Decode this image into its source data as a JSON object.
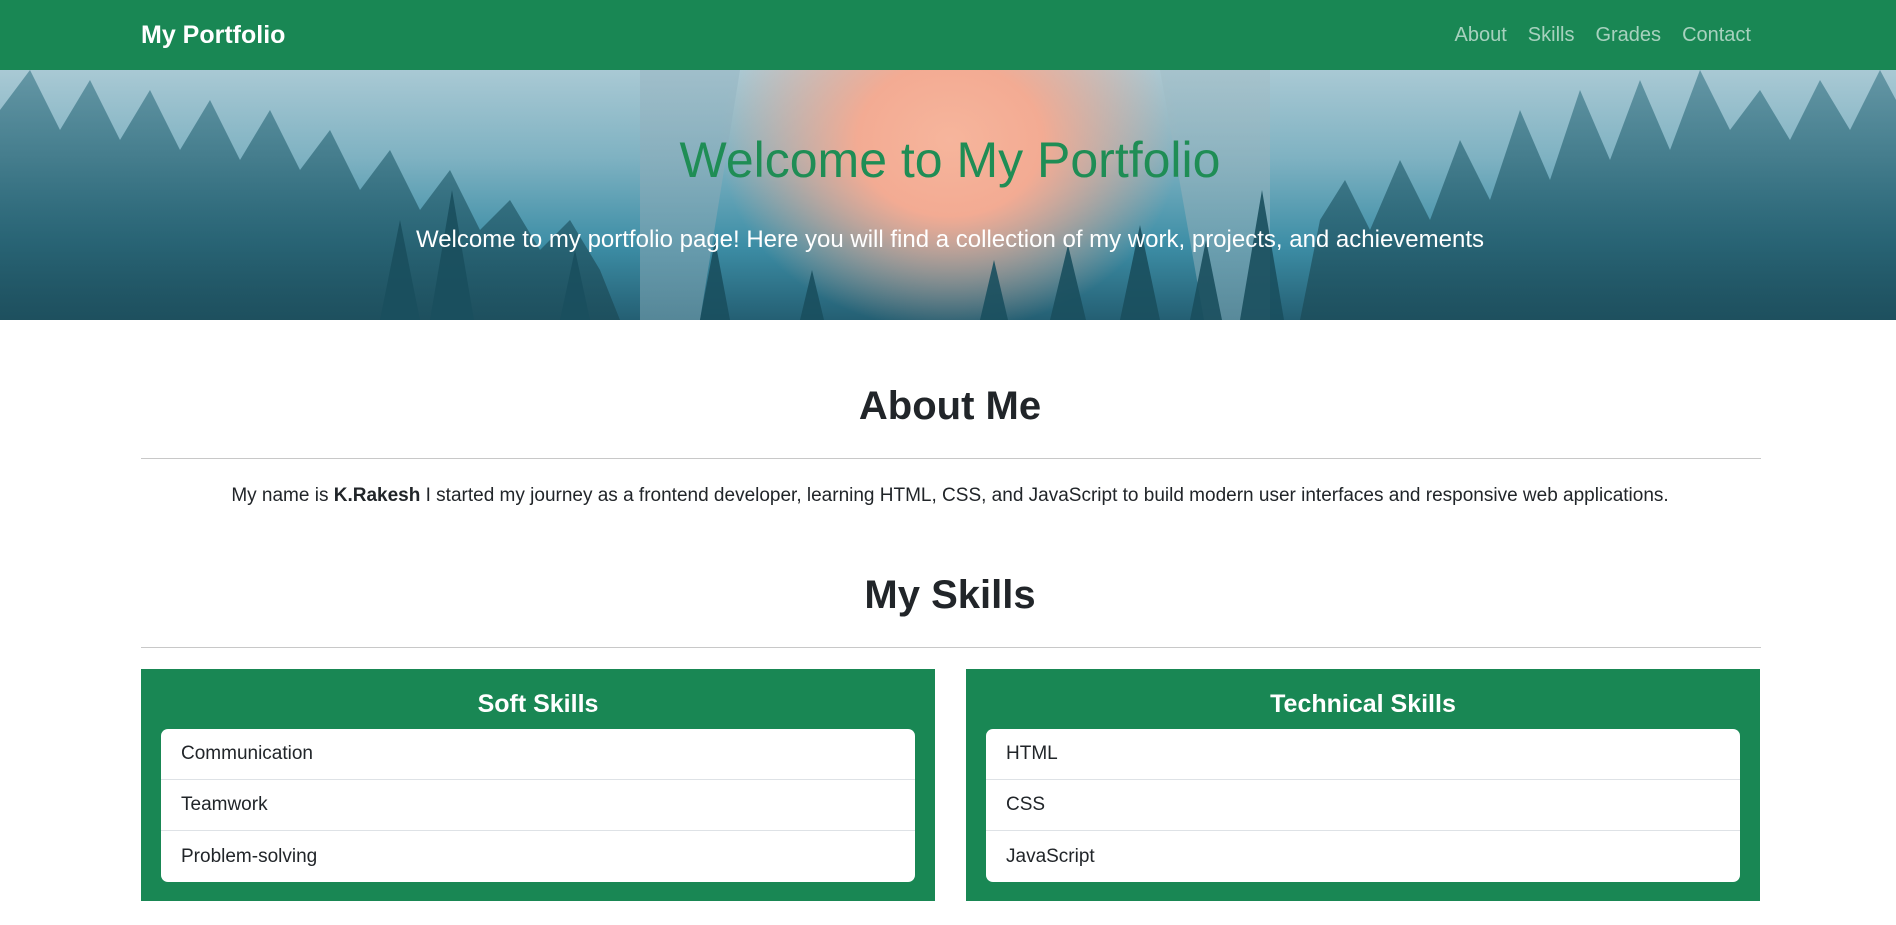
{
  "navbar": {
    "brand": "My Portfolio",
    "links": [
      "About",
      "Skills",
      "Grades",
      "Contact"
    ],
    "color": "#198754"
  },
  "hero": {
    "title": "Welcome to My Portfolio",
    "subtitle": "Welcome to my portfolio page! Here you will find a collection of my work, projects, and achievements"
  },
  "about": {
    "heading": "About Me",
    "text_before": "My name is ",
    "name": "K.Rakesh",
    "text_after": " I started my journey as a frontend developer, learning HTML, CSS, and JavaScript to build modern user interfaces and responsive web applications."
  },
  "skills": {
    "heading": "My Skills",
    "soft": {
      "title": "Soft Skills",
      "items": [
        "Communication",
        "Teamwork",
        "Problem-solving"
      ]
    },
    "technical": {
      "title": "Technical Skills",
      "items": [
        "HTML",
        "CSS",
        "JavaScript"
      ]
    }
  }
}
